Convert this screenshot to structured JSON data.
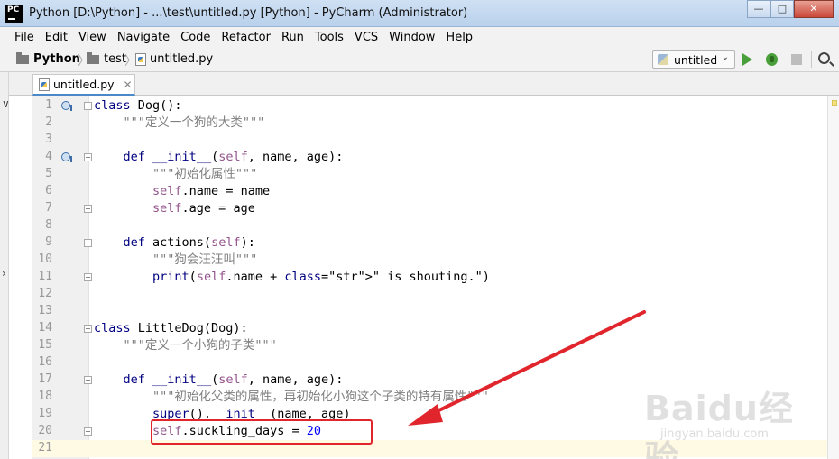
{
  "window": {
    "title": "Python [D:\\Python] - ...\\test\\untitled.py [Python] - PyCharm (Administrator)",
    "logo_text": "PC",
    "controls": [
      "—",
      "□",
      "✕"
    ]
  },
  "menu": [
    {
      "label": "File",
      "mnemonic": "F"
    },
    {
      "label": "Edit",
      "mnemonic": "E"
    },
    {
      "label": "View",
      "mnemonic": "V"
    },
    {
      "label": "Navigate",
      "mnemonic": "N"
    },
    {
      "label": "Code",
      "mnemonic": "C"
    },
    {
      "label": "Refactor",
      "mnemonic": "R"
    },
    {
      "label": "Run",
      "mnemonic": "u"
    },
    {
      "label": "Tools",
      "mnemonic": "T"
    },
    {
      "label": "VCS",
      "mnemonic": "S"
    },
    {
      "label": "Window",
      "mnemonic": "W"
    },
    {
      "label": "Help",
      "mnemonic": "H"
    }
  ],
  "breadcrumb": {
    "project": "Python",
    "folder": "test",
    "file": "untitled.py"
  },
  "run_config": {
    "selected": "untitled",
    "icons": [
      "python-icon",
      "run-icon",
      "debug-icon",
      "stop-icon",
      "search-icon"
    ]
  },
  "editor_tab": {
    "label": "untitled.py"
  },
  "code_lines": [
    {
      "n": "1",
      "text": "class Dog():"
    },
    {
      "n": "2",
      "text": "    \"\"\"定义一个狗的大类\"\"\""
    },
    {
      "n": "3",
      "text": ""
    },
    {
      "n": "4",
      "text": "    def __init__(self, name, age):"
    },
    {
      "n": "5",
      "text": "        \"\"\"初始化属性\"\"\""
    },
    {
      "n": "6",
      "text": "        self.name = name"
    },
    {
      "n": "7",
      "text": "        self.age = age"
    },
    {
      "n": "8",
      "text": ""
    },
    {
      "n": "9",
      "text": "    def actions(self):"
    },
    {
      "n": "10",
      "text": "        \"\"\"狗会汪汪叫\"\"\""
    },
    {
      "n": "11",
      "text": "        print(self.name + \" is shouting.\")"
    },
    {
      "n": "12",
      "text": ""
    },
    {
      "n": "13",
      "text": ""
    },
    {
      "n": "14",
      "text": "class LittleDog(Dog):"
    },
    {
      "n": "15",
      "text": "    \"\"\"定义一个小狗的子类\"\"\""
    },
    {
      "n": "16",
      "text": ""
    },
    {
      "n": "17",
      "text": "    def __init__(self, name, age):"
    },
    {
      "n": "18",
      "text": "        \"\"\"初始化父类的属性，再初始化小狗这个子类的特有属性\"\"\""
    },
    {
      "n": "19",
      "text": "        super().__init__(name, age)"
    },
    {
      "n": "20",
      "text": "        self.suckling_days = 20"
    },
    {
      "n": "21",
      "text": ""
    }
  ],
  "current_line": "21",
  "watermark": {
    "brand": "Baiஙdu经验",
    "brand_display": "Baidu经验",
    "url": "jingyan.baidu.com"
  },
  "colors": {
    "keyword": "#000080",
    "self": "#94558d",
    "docstring": "#808080",
    "number": "#0000ff",
    "string": "#008080",
    "annotation": "#e0262c",
    "current_line": "#fffae3"
  }
}
